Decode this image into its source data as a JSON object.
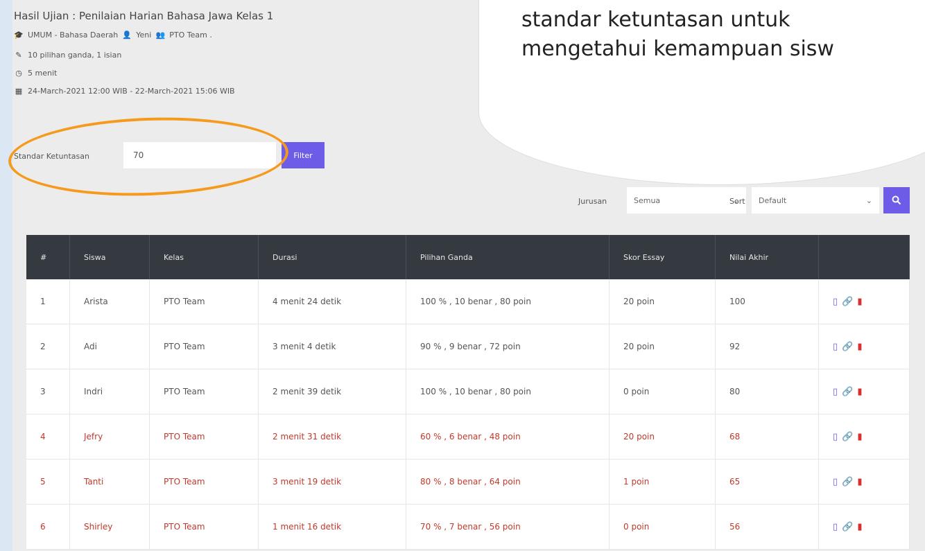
{
  "header": {
    "title": "Hasil Ujian : Penilaian Harian Bahasa Jawa Kelas 1",
    "category": "UMUM - Bahasa Daerah",
    "author": "Yeni",
    "team": "PTO Team .",
    "questions": "10 pilihan ganda, 1 isian",
    "duration": "5 menit",
    "date_range": "24-March-2021 12:00 WIB - 22-March-2021 15:06 WIB"
  },
  "standard": {
    "label": "Standar Ketuntasan",
    "value": "70",
    "button": "Filter"
  },
  "callout": {
    "line1": "standar ketuntasan untuk",
    "line2": "mengetahui kemampuan sisw"
  },
  "filters": {
    "jurusan_label": "Jurusan",
    "jurusan_value": "Semua",
    "sort_label": "Sort",
    "sort_value": "Default"
  },
  "table": {
    "headers": [
      "#",
      "Siswa",
      "Kelas",
      "Durasi",
      "Pilihan Ganda",
      "Skor Essay",
      "Nilai Akhir",
      ""
    ],
    "rows": [
      {
        "no": "1",
        "name": "Arista",
        "kelas": "PTO Team",
        "durasi": "4 menit 24 detik",
        "pg": "100 % , 10 benar , 80 poin",
        "essay": "20 poin",
        "nilai": "100",
        "fail": false
      },
      {
        "no": "2",
        "name": "Adi",
        "kelas": "PTO Team",
        "durasi": "3 menit 4 detik",
        "pg": "90 % , 9 benar , 72 poin",
        "essay": "20 poin",
        "nilai": "92",
        "fail": false
      },
      {
        "no": "3",
        "name": "Indri",
        "kelas": "PTO Team",
        "durasi": "2 menit 39 detik",
        "pg": "100 % , 10 benar , 80 poin",
        "essay": "0 poin",
        "nilai": "80",
        "fail": false
      },
      {
        "no": "4",
        "name": "Jefry",
        "kelas": "PTO Team",
        "durasi": "2 menit 31 detik",
        "pg": "60 % , 6 benar , 48 poin",
        "essay": "20 poin",
        "nilai": "68",
        "fail": true
      },
      {
        "no": "5",
        "name": "Tanti",
        "kelas": "PTO Team",
        "durasi": "3 menit 19 detik",
        "pg": "80 % , 8 benar , 64 poin",
        "essay": "1 poin",
        "nilai": "65",
        "fail": true
      },
      {
        "no": "6",
        "name": "Shirley",
        "kelas": "PTO Team",
        "durasi": "1 menit 16 detik",
        "pg": "70 % , 7 benar , 56 poin",
        "essay": "0 poin",
        "nilai": "56",
        "fail": true
      }
    ]
  },
  "colors": {
    "accent": "#6c5ce7",
    "fail_text": "#c0392b",
    "highlight_ring": "#f59a1c",
    "table_header": "#343a40"
  }
}
